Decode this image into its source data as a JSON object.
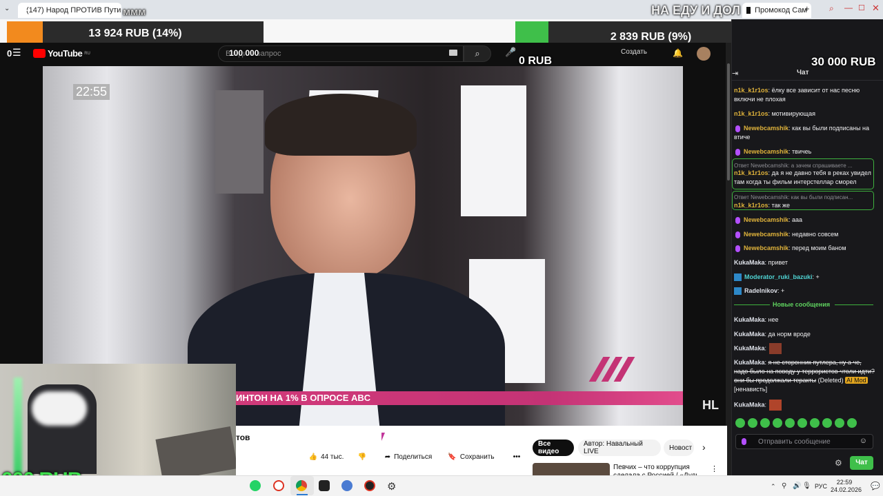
{
  "browser": {
    "tab_left_title": "(147) Народ ПРОТИВ Пути",
    "tab_right_title": "Промокод Сам",
    "overlay_mmm": "ммм",
    "overlay_top_right": "НА ЕДУ И ДОЛ"
  },
  "donations": {
    "left": {
      "text": "13 924 RUB (14%)",
      "percent": 14,
      "fill_color": "#f28a1e"
    },
    "right": {
      "text": "2 839 RUB (9%)",
      "percent": 9,
      "fill_color": "#3fbf4a"
    },
    "goal_left": "100 000",
    "goal_right_start": "0 RUB",
    "goal_right_end": "30 000 RUB",
    "cam_rub": "000 RUB"
  },
  "youtube": {
    "logo_text": "YouTube",
    "logo_region": "RU",
    "search_placeholder": "Введите запрос",
    "create_label": "Создать",
    "menu_prefix": "0"
  },
  "video": {
    "timecode": "22:55",
    "banner_text": "ИНТОН НА 1% В ОПРОСЕ ABC",
    "title_fragment": "тов",
    "likes": "44 тыс.",
    "share": "Поделиться",
    "save": "Сохранить",
    "channel_watermark": "HL"
  },
  "recommend": {
    "chips": [
      "Все видео",
      "Автор: Навальный LIVE",
      "Новост"
    ],
    "first_title": "Певчих – что коррупция сделала с Россией / «Дудь"
  },
  "chat": {
    "header": "Чат",
    "messages": [
      {
        "user": "n1k_k1r1os",
        "text": "ёлку все зависит от нас песню включи не плохая"
      },
      {
        "user": "n1k_k1r1os",
        "text": "мотивирующая"
      },
      {
        "user": "Newebcamshik",
        "text": "как вы были подписаны на втиче"
      },
      {
        "user": "Newebcamshik",
        "text": "твичеь"
      },
      {
        "reply_to": "Ответ Newebcamshik: а зачем спрашиваете ...",
        "user": "n1k_k1r1os",
        "text": "да я не давно тебя в реках увидел там когда ты фильм интерстеллар сморел"
      },
      {
        "reply_to": "Ответ Newebcamshik: как вы были подписан...",
        "user": "n1k_k1r1os",
        "text": "так же"
      },
      {
        "user": "Newebcamshik",
        "text": "ааа"
      },
      {
        "user": "Newebcamshik",
        "text": "недавно совсем"
      },
      {
        "user": "Newebcamshik",
        "text": "перед моим баном"
      },
      {
        "user": "KukaMaka",
        "text": "привет"
      },
      {
        "user": "Moderator_ruki_bazuki",
        "text": "+"
      },
      {
        "user": "Radelnikov",
        "text": "+"
      },
      {
        "divider": "Новые сообщения"
      },
      {
        "user": "KukaMaka",
        "text": "нее"
      },
      {
        "user": "KukaMaka",
        "text": "да норм вроде"
      },
      {
        "user": "KukaMaka",
        "text": ""
      },
      {
        "user": "KukaMaka",
        "text": "я не сторонник путлера, ну а че, надо было на поводу у террористов чтоли идти? они бы продолжали теракты",
        "deleted": "(Deleted)",
        "mod_badge": "AI Mod",
        "reason": "[ненависть]"
      },
      {
        "user": "KukaMaka",
        "text": ""
      }
    ],
    "input_placeholder": "Отправить сообщение",
    "send_button": "Чат"
  },
  "taskbar": {
    "lang": "РУС",
    "time": "22:59",
    "date": "24.02.2026"
  }
}
